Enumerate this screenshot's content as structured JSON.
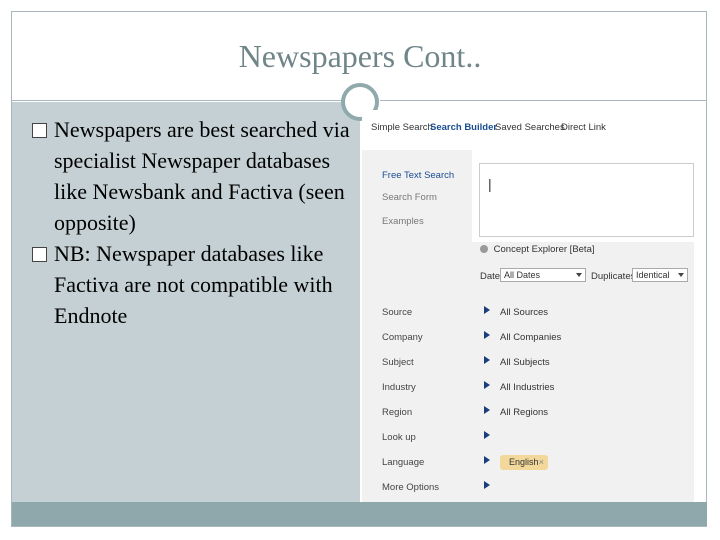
{
  "slide": {
    "title": "Newspapers Cont..",
    "bullets": [
      "Newspapers are best searched via specialist Newspaper databases like Newsbank and Factiva (seen opposite)",
      "NB: Newspaper databases like Factiva are not compatible with Endnote"
    ]
  },
  "search": {
    "tabs": [
      "Simple Search",
      "Search Builder",
      "Saved Searches",
      "Direct Link"
    ],
    "active_tab": "Search Builder",
    "left_links": [
      "Free Text Search",
      "Search Form",
      "Examples"
    ],
    "text_cursor": "|",
    "concept_explorer": "Concept Explorer [Beta]",
    "date_label": "Date",
    "date_value": "All Dates",
    "duplicates_label": "Duplicates",
    "duplicates_value": "Identical",
    "filters": [
      {
        "label": "Source",
        "value": "All Sources"
      },
      {
        "label": "Company",
        "value": "All Companies"
      },
      {
        "label": "Subject",
        "value": "All Subjects"
      },
      {
        "label": "Industry",
        "value": "All Industries"
      },
      {
        "label": "Region",
        "value": "All Regions"
      },
      {
        "label": "Look up",
        "value": ""
      },
      {
        "label": "Language",
        "value": ""
      },
      {
        "label": "More Options",
        "value": ""
      }
    ],
    "language_chip": "English",
    "chip_close": "×"
  },
  "colors": {
    "panel": "#c4d0d3",
    "bar": "#8ea8ac",
    "title": "#6f8588",
    "link": "#1a4d8f",
    "chip": "#f2d89a"
  }
}
